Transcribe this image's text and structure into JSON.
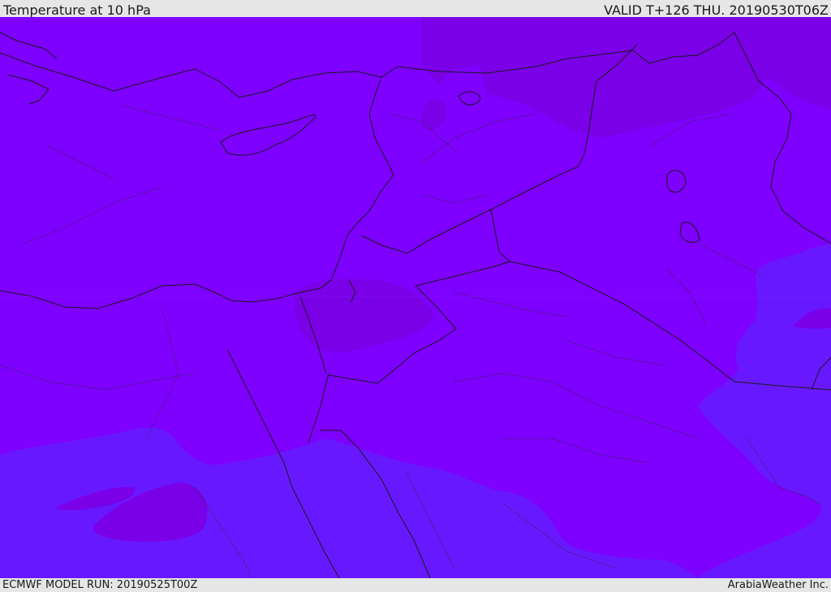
{
  "header": {
    "title": "Temperature at 10 hPa",
    "valid": "VALID T+126 THU. 20190530T06Z"
  },
  "footer": {
    "model_run": "ECMWF MODEL RUN: 20190525T00Z",
    "credit": "ArabiaWeather Inc."
  },
  "colors": {
    "base_field": "#7e00ff",
    "warm_field": "#7a00e8",
    "cool_field": "#6818ff",
    "border_line": "#1a1a1a",
    "admin_line": "#2b2b2b",
    "bar_background": "#e6e6e6"
  }
}
